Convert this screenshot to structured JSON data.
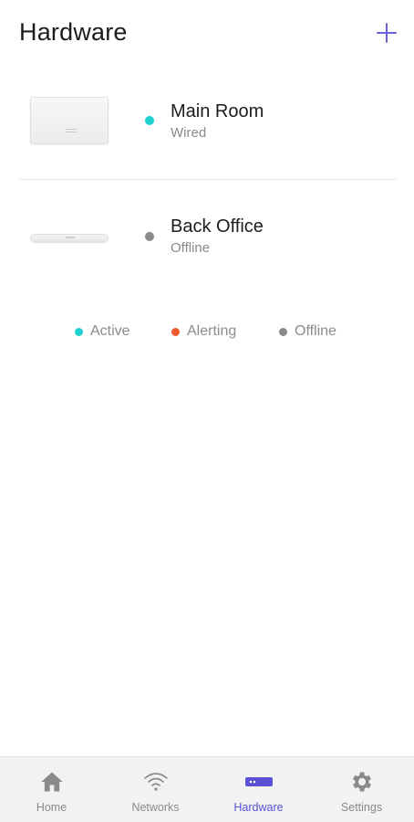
{
  "header": {
    "title": "Hardware",
    "add_icon": "plus-icon"
  },
  "devices": [
    {
      "name": "Main Room",
      "connection": "Wired",
      "status": "active",
      "status_color": "#1fd1d1",
      "image": "wall-router"
    },
    {
      "name": "Back Office",
      "connection": "Offline",
      "status": "offline",
      "status_color": "#8a8a8a",
      "image": "flat-access-point"
    }
  ],
  "legend": [
    {
      "label": "Active",
      "color": "#1fd1d1"
    },
    {
      "label": "Alerting",
      "color": "#ee5a2b"
    },
    {
      "label": "Offline",
      "color": "#8a8a8a"
    }
  ],
  "tabs": [
    {
      "label": "Home",
      "icon": "home-icon",
      "active": false
    },
    {
      "label": "Networks",
      "icon": "wifi-icon",
      "active": false
    },
    {
      "label": "Hardware",
      "icon": "hardware-icon",
      "active": true
    },
    {
      "label": "Settings",
      "icon": "gear-icon",
      "active": false
    }
  ],
  "colors": {
    "accent": "#5a50d6",
    "inactive": "#8a8a8a",
    "text": "#1c1c1c"
  }
}
